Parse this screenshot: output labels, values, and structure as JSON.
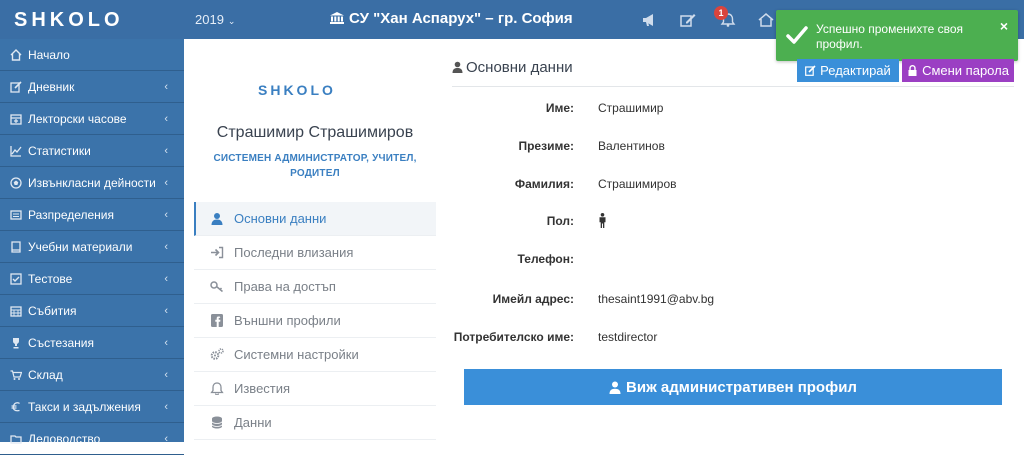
{
  "header": {
    "logo": "SHKOLO",
    "year": "2019",
    "school": "СУ \"Хан Аспарух\" – гр. София",
    "notification_count": "1",
    "icons": [
      "megaphone-icon",
      "edit-icon",
      "bell-icon",
      "home-icon"
    ]
  },
  "toast": {
    "message": "Успешно променихте своя профил.",
    "close": "×"
  },
  "sidebar": {
    "items": [
      {
        "label": "Начало",
        "icon": "home-icon",
        "arrow": false
      },
      {
        "label": "Дневник",
        "icon": "edit-icon",
        "arrow": true
      },
      {
        "label": "Лекторски часове",
        "icon": "calendar-icon",
        "arrow": true
      },
      {
        "label": "Статистики",
        "icon": "chart-icon",
        "arrow": true
      },
      {
        "label": "Извънкласни дейности",
        "icon": "ball-icon",
        "arrow": true
      },
      {
        "label": "Разпределения",
        "icon": "list-icon",
        "arrow": true
      },
      {
        "label": "Учебни материали",
        "icon": "book-icon",
        "arrow": true
      },
      {
        "label": "Тестове",
        "icon": "check-square-icon",
        "arrow": true
      },
      {
        "label": "Събития",
        "icon": "calendar-grid-icon",
        "arrow": true
      },
      {
        "label": "Състезания",
        "icon": "trophy-icon",
        "arrow": true
      },
      {
        "label": "Склад",
        "icon": "cart-icon",
        "arrow": true
      },
      {
        "label": "Такси и задължения",
        "icon": "euro-icon",
        "arrow": true
      },
      {
        "label": "Деловодство",
        "icon": "folder-icon",
        "arrow": true
      }
    ],
    "arrow_glyph": "‹"
  },
  "profile": {
    "logo": "SHKOLO",
    "name": "Страшимир Страшимиров",
    "roles": "СИСТЕМЕН АДМИНИСТРАТОР, УЧИТЕЛ, РОДИТЕЛ",
    "menu": [
      {
        "label": "Основни данни",
        "icon": "user-icon",
        "active": true
      },
      {
        "label": "Последни влизания",
        "icon": "sign-in-icon",
        "active": false
      },
      {
        "label": "Права на достъп",
        "icon": "key-icon",
        "active": false
      },
      {
        "label": "Външни профили",
        "icon": "facebook-icon",
        "active": false
      },
      {
        "label": "Системни настройки",
        "icon": "cogs-icon",
        "active": false
      },
      {
        "label": "Известия",
        "icon": "bell-outline-icon",
        "active": false
      },
      {
        "label": "Данни",
        "icon": "database-icon",
        "active": false
      }
    ]
  },
  "main": {
    "title": "Основни данни",
    "edit_button": "Редактирай",
    "password_button": "Смени парола",
    "fields": [
      {
        "label": "Име:",
        "value": "Страшимир"
      },
      {
        "label": "Презиме:",
        "value": "Валентинов"
      },
      {
        "label": "Фамилия:",
        "value": "Страшимиров"
      },
      {
        "label": "Пол:",
        "value": "",
        "icon": "male-icon"
      },
      {
        "label": "Телефон:",
        "value": ""
      },
      {
        "label": "Имейл адрес:",
        "value": "thesaint1991@abv.bg"
      },
      {
        "label": "Потребителско име:",
        "value": "testdirector"
      }
    ],
    "admin_button": "Виж административен профил"
  },
  "colors": {
    "header": "#3a6ea5",
    "sidebar": "#3b73aa",
    "primary": "#3a8fd9",
    "purple": "#9b3fc3",
    "success": "#4caf50",
    "badge": "#d9443d"
  }
}
